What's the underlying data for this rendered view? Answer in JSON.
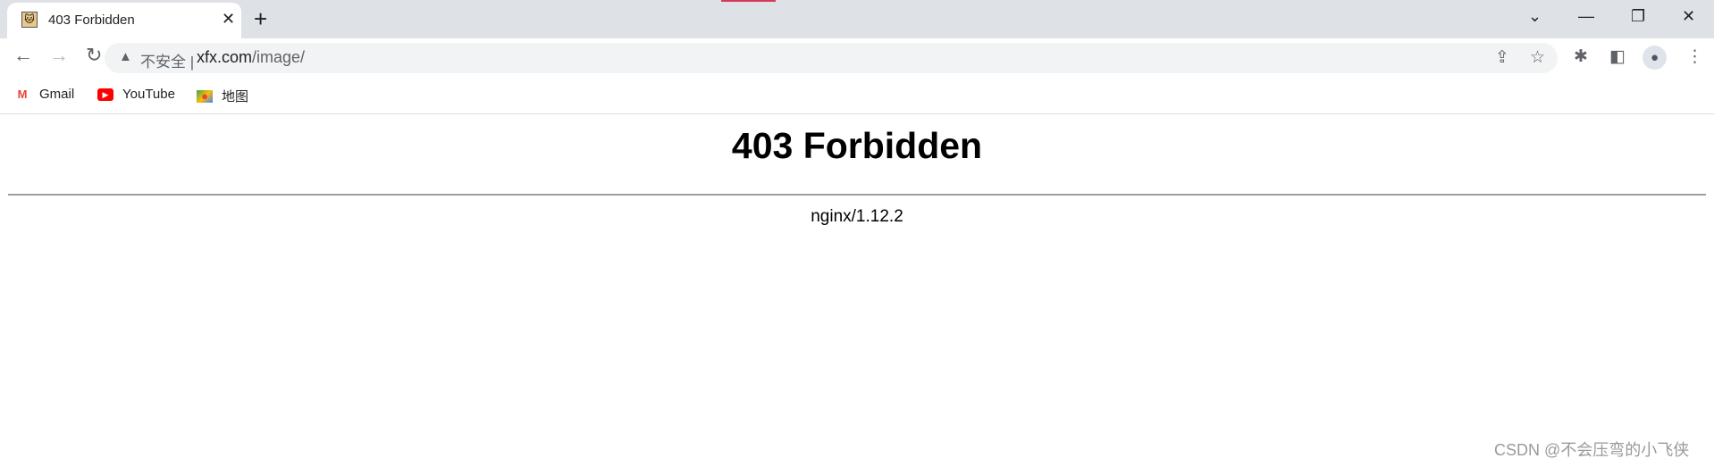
{
  "browser": {
    "tab": {
      "title": "403 Forbidden",
      "favicon": "tomcat-icon"
    },
    "new_tab": "+",
    "address": {
      "security_label": "不安全",
      "url_host": "xfx.com",
      "url_path": "/image/"
    },
    "bookmarks": [
      {
        "label": "Gmail",
        "icon": "gmail-icon",
        "color": "#ea4335"
      },
      {
        "label": "YouTube",
        "icon": "youtube-icon",
        "color": "#ff0000"
      },
      {
        "label": "地图",
        "icon": "maps-icon",
        "color": "#34a853"
      }
    ]
  },
  "page": {
    "heading": "403 Forbidden",
    "server": "nginx/1.12.2"
  },
  "watermark": "CSDN @不会压弯的小飞侠"
}
